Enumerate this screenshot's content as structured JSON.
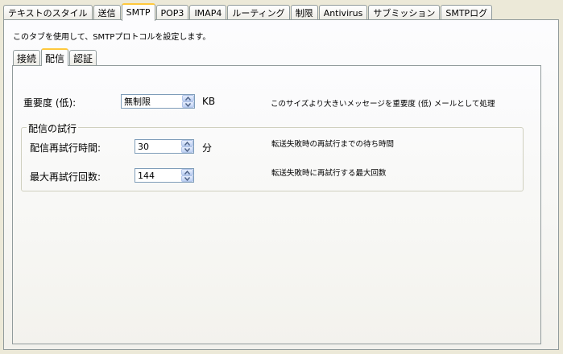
{
  "top_tabs": [
    {
      "label": "テキストのスタイル",
      "active": false
    },
    {
      "label": "送信",
      "active": false
    },
    {
      "label": "SMTP",
      "active": true
    },
    {
      "label": "POP3",
      "active": false
    },
    {
      "label": "IMAP4",
      "active": false
    },
    {
      "label": "ルーティング",
      "active": false
    },
    {
      "label": "制限",
      "active": false
    },
    {
      "label": "Antivirus",
      "active": false
    },
    {
      "label": "サブミッション",
      "active": false
    },
    {
      "label": "SMTPログ",
      "active": false
    }
  ],
  "description": "このタブを使用して、SMTPプロトコルを設定します。",
  "sub_tabs": [
    {
      "label": "接続",
      "active": false
    },
    {
      "label": "配信",
      "active": true
    },
    {
      "label": "認証",
      "active": false
    }
  ],
  "priority_low": {
    "label": "重要度 (低):",
    "value": "無制限",
    "unit": "KB",
    "hint": "このサイズより大きいメッセージを重要度 (低) メールとして処理"
  },
  "retry_group": {
    "title": "配信の試行",
    "retry_interval": {
      "label": "配信再試行時間:",
      "value": "30",
      "unit": "分",
      "hint": "転送失敗時の再試行までの待ち時間"
    },
    "max_retries": {
      "label": "最大再試行回数:",
      "value": "144",
      "hint": "転送失敗時に再試行する最大回数"
    }
  },
  "icons": {
    "spin_up": "chevron-up-icon",
    "spin_down": "chevron-down-icon"
  },
  "colors": {
    "window_bg": "#ece9d8",
    "tab_border": "#919b9c",
    "active_tab_accent": "#ffc83c",
    "field_border": "#7f9db9"
  }
}
